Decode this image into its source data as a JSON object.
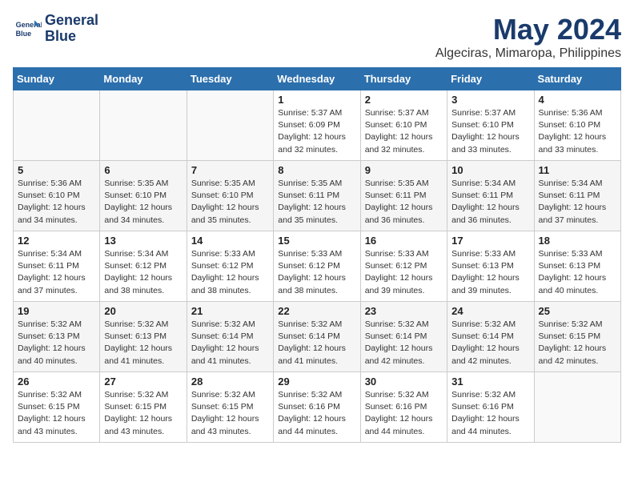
{
  "header": {
    "logo_line1": "General",
    "logo_line2": "Blue",
    "month": "May 2024",
    "location": "Algeciras, Mimaropa, Philippines"
  },
  "days_of_week": [
    "Sunday",
    "Monday",
    "Tuesday",
    "Wednesday",
    "Thursday",
    "Friday",
    "Saturday"
  ],
  "weeks": [
    [
      {
        "day": "",
        "info": ""
      },
      {
        "day": "",
        "info": ""
      },
      {
        "day": "",
        "info": ""
      },
      {
        "day": "1",
        "info": "Sunrise: 5:37 AM\nSunset: 6:09 PM\nDaylight: 12 hours\nand 32 minutes."
      },
      {
        "day": "2",
        "info": "Sunrise: 5:37 AM\nSunset: 6:10 PM\nDaylight: 12 hours\nand 32 minutes."
      },
      {
        "day": "3",
        "info": "Sunrise: 5:37 AM\nSunset: 6:10 PM\nDaylight: 12 hours\nand 33 minutes."
      },
      {
        "day": "4",
        "info": "Sunrise: 5:36 AM\nSunset: 6:10 PM\nDaylight: 12 hours\nand 33 minutes."
      }
    ],
    [
      {
        "day": "5",
        "info": "Sunrise: 5:36 AM\nSunset: 6:10 PM\nDaylight: 12 hours\nand 34 minutes."
      },
      {
        "day": "6",
        "info": "Sunrise: 5:35 AM\nSunset: 6:10 PM\nDaylight: 12 hours\nand 34 minutes."
      },
      {
        "day": "7",
        "info": "Sunrise: 5:35 AM\nSunset: 6:10 PM\nDaylight: 12 hours\nand 35 minutes."
      },
      {
        "day": "8",
        "info": "Sunrise: 5:35 AM\nSunset: 6:11 PM\nDaylight: 12 hours\nand 35 minutes."
      },
      {
        "day": "9",
        "info": "Sunrise: 5:35 AM\nSunset: 6:11 PM\nDaylight: 12 hours\nand 36 minutes."
      },
      {
        "day": "10",
        "info": "Sunrise: 5:34 AM\nSunset: 6:11 PM\nDaylight: 12 hours\nand 36 minutes."
      },
      {
        "day": "11",
        "info": "Sunrise: 5:34 AM\nSunset: 6:11 PM\nDaylight: 12 hours\nand 37 minutes."
      }
    ],
    [
      {
        "day": "12",
        "info": "Sunrise: 5:34 AM\nSunset: 6:11 PM\nDaylight: 12 hours\nand 37 minutes."
      },
      {
        "day": "13",
        "info": "Sunrise: 5:34 AM\nSunset: 6:12 PM\nDaylight: 12 hours\nand 38 minutes."
      },
      {
        "day": "14",
        "info": "Sunrise: 5:33 AM\nSunset: 6:12 PM\nDaylight: 12 hours\nand 38 minutes."
      },
      {
        "day": "15",
        "info": "Sunrise: 5:33 AM\nSunset: 6:12 PM\nDaylight: 12 hours\nand 38 minutes."
      },
      {
        "day": "16",
        "info": "Sunrise: 5:33 AM\nSunset: 6:12 PM\nDaylight: 12 hours\nand 39 minutes."
      },
      {
        "day": "17",
        "info": "Sunrise: 5:33 AM\nSunset: 6:13 PM\nDaylight: 12 hours\nand 39 minutes."
      },
      {
        "day": "18",
        "info": "Sunrise: 5:33 AM\nSunset: 6:13 PM\nDaylight: 12 hours\nand 40 minutes."
      }
    ],
    [
      {
        "day": "19",
        "info": "Sunrise: 5:32 AM\nSunset: 6:13 PM\nDaylight: 12 hours\nand 40 minutes."
      },
      {
        "day": "20",
        "info": "Sunrise: 5:32 AM\nSunset: 6:13 PM\nDaylight: 12 hours\nand 41 minutes."
      },
      {
        "day": "21",
        "info": "Sunrise: 5:32 AM\nSunset: 6:14 PM\nDaylight: 12 hours\nand 41 minutes."
      },
      {
        "day": "22",
        "info": "Sunrise: 5:32 AM\nSunset: 6:14 PM\nDaylight: 12 hours\nand 41 minutes."
      },
      {
        "day": "23",
        "info": "Sunrise: 5:32 AM\nSunset: 6:14 PM\nDaylight: 12 hours\nand 42 minutes."
      },
      {
        "day": "24",
        "info": "Sunrise: 5:32 AM\nSunset: 6:14 PM\nDaylight: 12 hours\nand 42 minutes."
      },
      {
        "day": "25",
        "info": "Sunrise: 5:32 AM\nSunset: 6:15 PM\nDaylight: 12 hours\nand 42 minutes."
      }
    ],
    [
      {
        "day": "26",
        "info": "Sunrise: 5:32 AM\nSunset: 6:15 PM\nDaylight: 12 hours\nand 43 minutes."
      },
      {
        "day": "27",
        "info": "Sunrise: 5:32 AM\nSunset: 6:15 PM\nDaylight: 12 hours\nand 43 minutes."
      },
      {
        "day": "28",
        "info": "Sunrise: 5:32 AM\nSunset: 6:15 PM\nDaylight: 12 hours\nand 43 minutes."
      },
      {
        "day": "29",
        "info": "Sunrise: 5:32 AM\nSunset: 6:16 PM\nDaylight: 12 hours\nand 44 minutes."
      },
      {
        "day": "30",
        "info": "Sunrise: 5:32 AM\nSunset: 6:16 PM\nDaylight: 12 hours\nand 44 minutes."
      },
      {
        "day": "31",
        "info": "Sunrise: 5:32 AM\nSunset: 6:16 PM\nDaylight: 12 hours\nand 44 minutes."
      },
      {
        "day": "",
        "info": ""
      }
    ]
  ]
}
